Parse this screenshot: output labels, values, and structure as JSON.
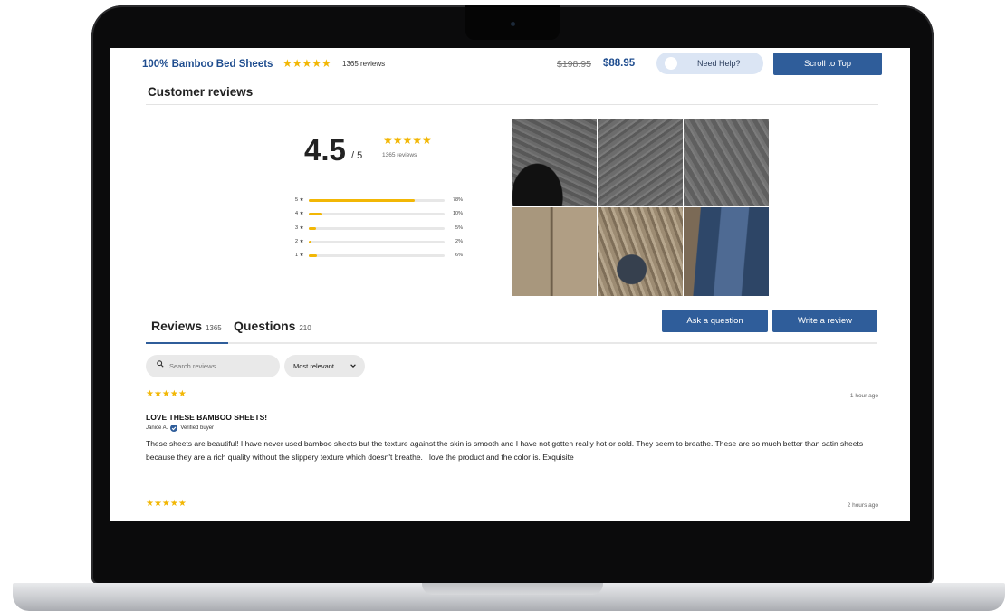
{
  "header": {
    "product_title": "100% Bamboo Bed Sheets",
    "stars": "★★★★★",
    "review_count": "1365 reviews",
    "old_price": "$198.95",
    "price": "$88.95",
    "help_label": "Need Help?",
    "scroll_top_label": "Scroll to Top"
  },
  "summary": {
    "heading": "Customer reviews",
    "rating": "4.5",
    "out_of": "/ 5",
    "stars": "★★★★★",
    "review_count": "1365 reviews",
    "distribution": [
      {
        "label": "5 ★",
        "percent": 78,
        "percent_label": "78%"
      },
      {
        "label": "4 ★",
        "percent": 10,
        "percent_label": "10%"
      },
      {
        "label": "3 ★",
        "percent": 5,
        "percent_label": "5%"
      },
      {
        "label": "2 ★",
        "percent": 2,
        "percent_label": "2%"
      },
      {
        "label": "1 ★",
        "percent": 6,
        "percent_label": "6%"
      }
    ]
  },
  "tabs": {
    "reviews_label": "Reviews",
    "reviews_count": "1365",
    "questions_label": "Questions",
    "questions_count": "210",
    "active": "reviews"
  },
  "actions": {
    "ask_label": "Ask a question",
    "write_label": "Write a review"
  },
  "filters": {
    "search_placeholder": "Search reviews",
    "sort_label": "Most relevant"
  },
  "reviews": [
    {
      "stars": "★★★★★",
      "time": "1 hour ago",
      "title": "LOVE THESE BAMBOO SHEETS!",
      "author": "Janice A.",
      "badge": "Verified buyer",
      "body": "These sheets are beautiful! I have never used bamboo sheets but the texture against the skin is smooth and I have not gotten really hot or cold. They seem to breathe. These are so much better than satin sheets because they are a rich quality without the slippery texture which doesn't breathe. I love the product and the color is. Exquisite"
    },
    {
      "stars": "★★★★★",
      "time": "2 hours ago"
    }
  ],
  "colors": {
    "brand_blue": "#2f5d9a",
    "title_blue": "#1f4d8f",
    "star_gold": "#f2b705"
  }
}
